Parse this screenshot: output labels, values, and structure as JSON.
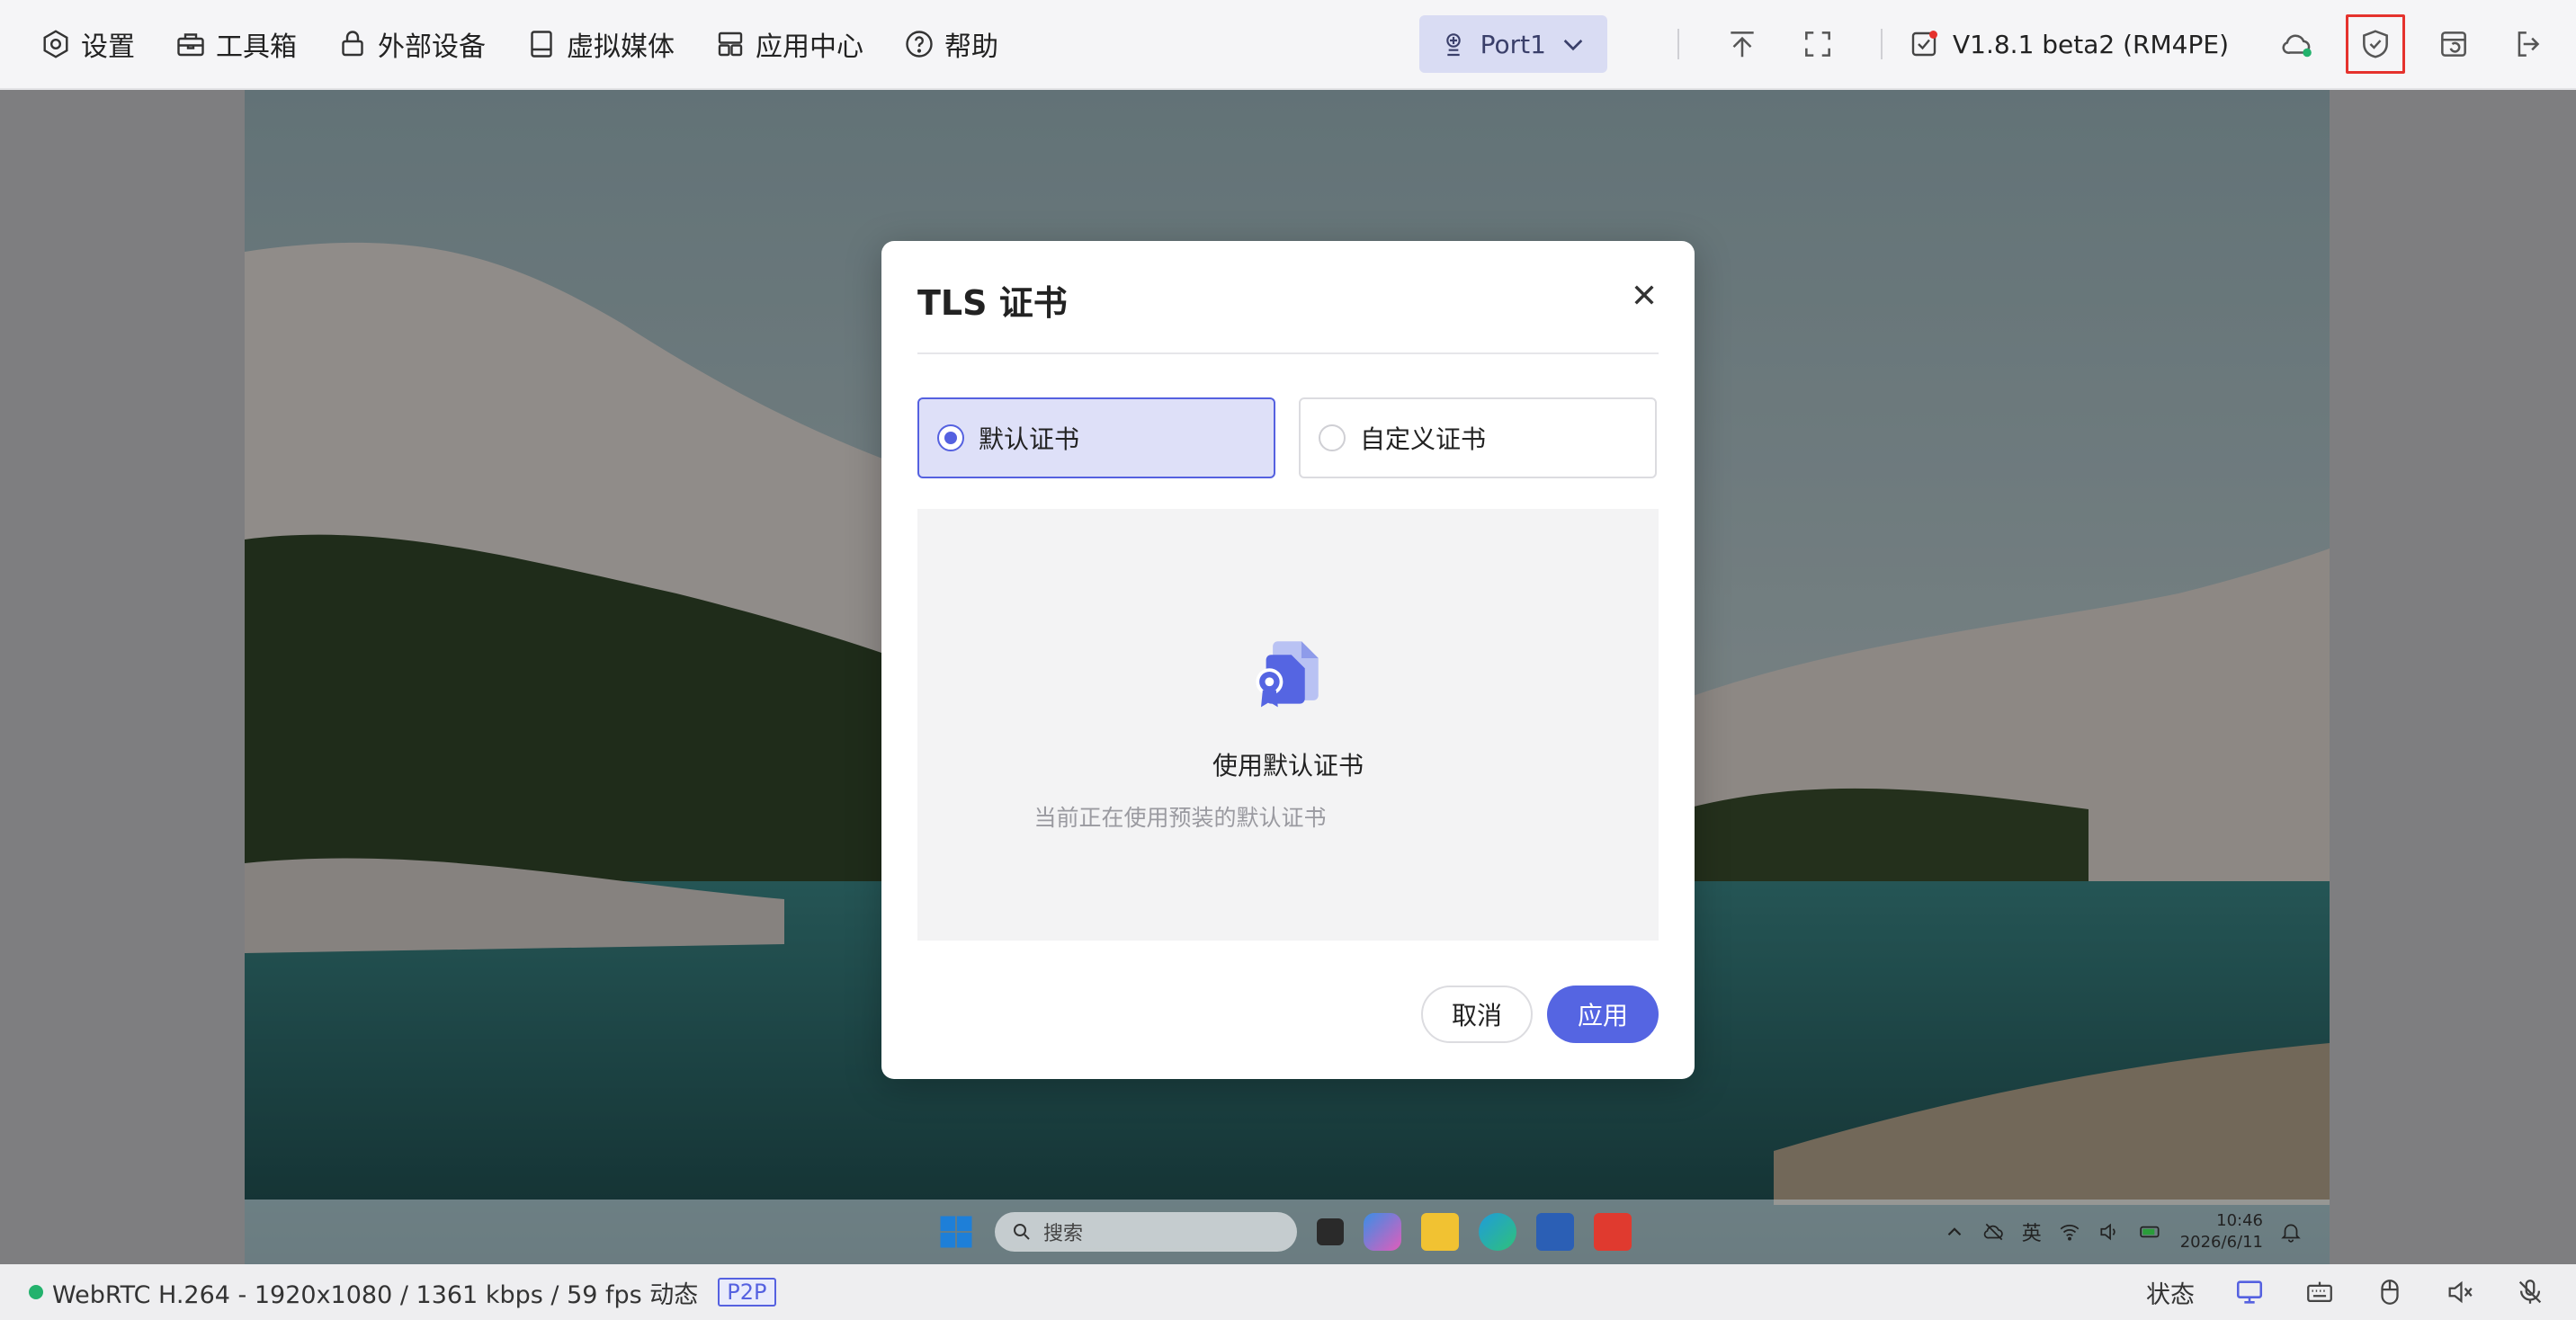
{
  "menu": [
    {
      "label": "设置",
      "icon": "settings-icon"
    },
    {
      "label": "工具箱",
      "icon": "toolbox-icon"
    },
    {
      "label": "外部设备",
      "icon": "lock-icon"
    },
    {
      "label": "虚拟媒体",
      "icon": "media-icon"
    },
    {
      "label": "应用中心",
      "icon": "apps-icon"
    },
    {
      "label": "帮助",
      "icon": "help-icon"
    }
  ],
  "toolbar": {
    "port_label": "Port1",
    "version_label": "V1.8.1 beta2 (RM4PE)"
  },
  "taskbar": {
    "search_placeholder": "搜索",
    "ime": "英",
    "time": "10:46",
    "date": "2026/6/11"
  },
  "dialog": {
    "title": "TLS 证书",
    "options": [
      {
        "label": "默认证书",
        "selected": true
      },
      {
        "label": "自定义证书",
        "selected": false
      }
    ],
    "panel_title": "使用默认证书",
    "panel_desc": "当前正在使用预装的默认证书",
    "cancel_label": "取消",
    "apply_label": "应用"
  },
  "statusbar": {
    "stream_info": "WebRTC H.264 - 1920x1080 / 1361 kbps / 59 fps 动态",
    "p2p": "P2P",
    "status_label": "状态"
  },
  "colors": {
    "accent": "#5565e2",
    "highlight": "#e5322d",
    "online": "#23b26d"
  }
}
